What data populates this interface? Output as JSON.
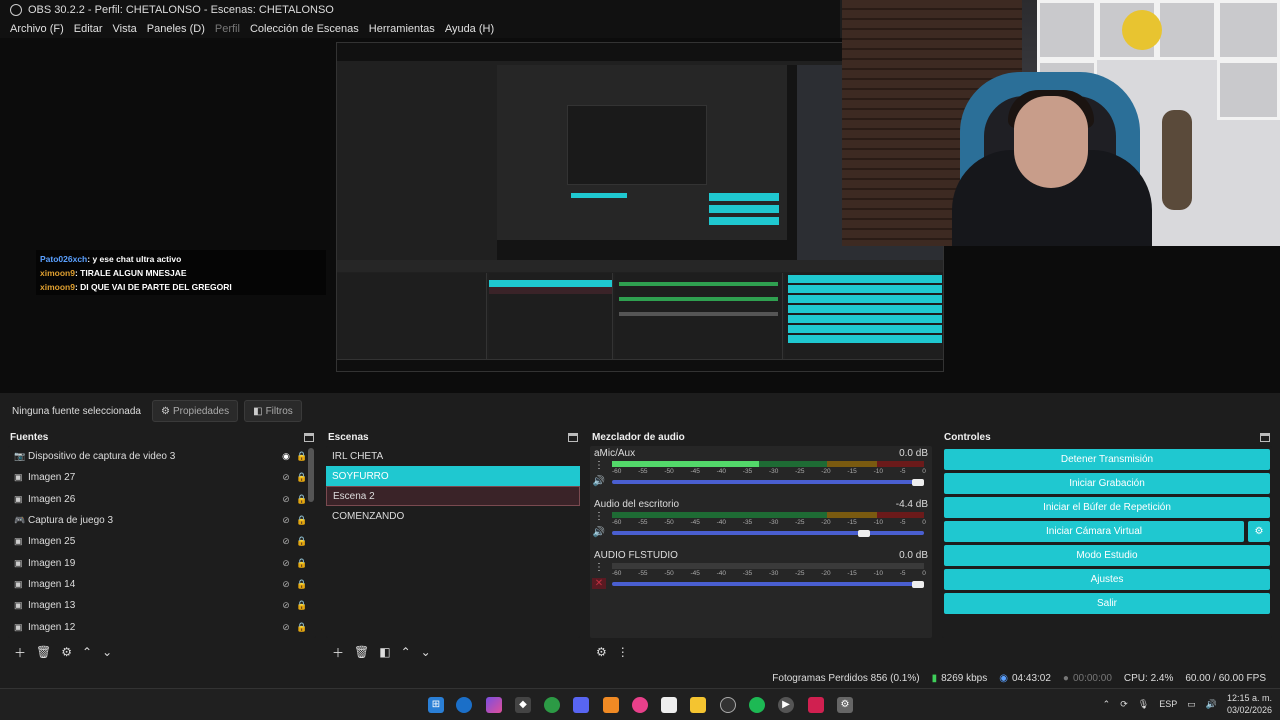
{
  "window": {
    "title": "OBS 30.2.2 - Perfil: CHETALONSO - Escenas: CHETALONSO"
  },
  "menu": [
    {
      "label": "Archivo (F)",
      "enabled": true
    },
    {
      "label": "Editar",
      "enabled": true
    },
    {
      "label": "Vista",
      "enabled": true
    },
    {
      "label": "Paneles (D)",
      "enabled": true
    },
    {
      "label": "Perfil",
      "enabled": false
    },
    {
      "label": "Colección de Escenas",
      "enabled": true
    },
    {
      "label": "Herramientas",
      "enabled": true
    },
    {
      "label": "Ayuda (H)",
      "enabled": true
    }
  ],
  "chat": [
    {
      "user": "Pato026xch",
      "text": ": y ese chat ultra activo"
    },
    {
      "user": "ximoon9",
      "text": ": TIRALE ALGUN MNESJAE"
    },
    {
      "user": "ximoon9",
      "text": ": DI QUE VAI DE PARTE DEL GREGORI"
    }
  ],
  "toolbar": {
    "no_source": "Ninguna fuente seleccionada",
    "properties": "Propiedades",
    "filters": "Filtros"
  },
  "sources": {
    "title": "Fuentes",
    "items": [
      {
        "name": "Dispositivo de captura de video 3",
        "icon": "camera-icon",
        "visible": true
      },
      {
        "name": "Imagen 27",
        "icon": "image-icon",
        "visible": false
      },
      {
        "name": "Imagen 26",
        "icon": "image-icon",
        "visible": false
      },
      {
        "name": "Captura de juego 3",
        "icon": "gamepad-icon",
        "visible": false
      },
      {
        "name": "Imagen 25",
        "icon": "image-icon",
        "visible": false
      },
      {
        "name": "Imagen 19",
        "icon": "image-icon",
        "visible": false
      },
      {
        "name": "Imagen 14",
        "icon": "image-icon",
        "visible": false
      },
      {
        "name": "Imagen 13",
        "icon": "image-icon",
        "visible": false
      },
      {
        "name": "Imagen 12",
        "icon": "image-icon",
        "visible": false
      }
    ]
  },
  "scenes": {
    "title": "Escenas",
    "items": [
      {
        "name": "IRL CHETA",
        "state": "normal"
      },
      {
        "name": "SOYFURRO",
        "state": "active"
      },
      {
        "name": "Escena 2",
        "state": "second"
      },
      {
        "name": "COMENZANDO",
        "state": "normal"
      }
    ]
  },
  "mixer": {
    "title": "Mezclador de audio",
    "scale": [
      "-60",
      "-55",
      "-50",
      "-45",
      "-40",
      "-35",
      "-30",
      "-25",
      "-20",
      "-15",
      "-10",
      "-5",
      "0"
    ],
    "channels": [
      {
        "name": "aMic/Aux",
        "db": "0.0 dB",
        "level": 0.47,
        "volume": 1.0,
        "muted": false
      },
      {
        "name": "Audio del escritorio",
        "db": "-4.4 dB",
        "level": 0.0,
        "volume": 0.82,
        "muted": false
      },
      {
        "name": "AUDIO FLSTUDIO",
        "db": "0.0 dB",
        "level": 0.0,
        "volume": 1.0,
        "muted": true
      }
    ]
  },
  "controls": {
    "title": "Controles",
    "buttons": [
      "Detener Transmisión",
      "Iniciar Grabación",
      "Iniciar el Búfer de Repetición",
      "Iniciar Cámara Virtual",
      "Modo Estudio",
      "Ajustes",
      "Salir"
    ]
  },
  "status": {
    "dropped": "Fotogramas Perdidos 856 (0.1%)",
    "bitrate": "8269 kbps",
    "stream_time": "04:43:02",
    "rec_time": "00:00:00",
    "cpu": "CPU: 2.4%",
    "fps": "60.00 / 60.00 FPS"
  },
  "taskbar": {
    "lang": "ESP",
    "time": "12:15 a. m.",
    "date": "03/02/2026"
  },
  "colors": {
    "accent": "#1fc8d0",
    "bg": "#1d1d1d"
  }
}
